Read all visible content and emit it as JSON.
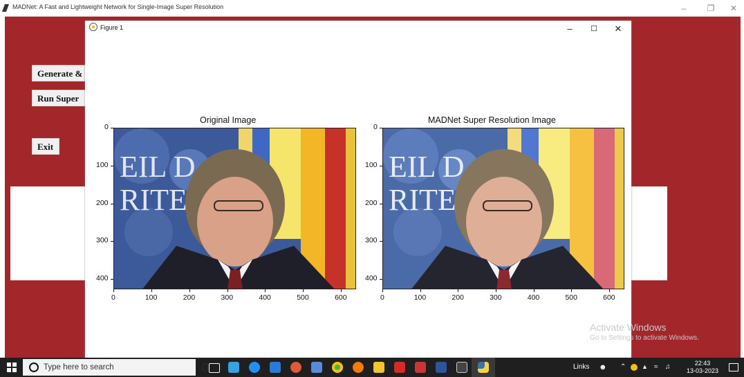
{
  "main_window": {
    "title": "MADNet: A Fast and Lightweight Network for Single-Image Super Resolution",
    "buttons": [
      "Generate &",
      "Run Super",
      "Exit"
    ],
    "background_color": "#a3262a"
  },
  "figure_window": {
    "title": "Figure 1",
    "controls": [
      "–",
      "☐",
      "✕"
    ],
    "plots": [
      {
        "title": "Original Image",
        "x_ticks": [
          "0",
          "100",
          "200",
          "300",
          "400",
          "500",
          "600"
        ],
        "y_ticks": [
          "0",
          "100",
          "200",
          "300",
          "400"
        ]
      },
      {
        "title": "MADNet Super Resolution Image",
        "x_ticks": [
          "0",
          "100",
          "200",
          "300",
          "400",
          "500",
          "600"
        ],
        "y_ticks": [
          "0",
          "100",
          "200",
          "300",
          "400"
        ]
      }
    ]
  },
  "watermark": {
    "line1": "Activate Windows",
    "line2": "Go to Settings to activate Windows."
  },
  "taskbar": {
    "search_placeholder": "Type here to search",
    "links_label": "Links",
    "time": "22:43",
    "date": "13-03-2023"
  }
}
